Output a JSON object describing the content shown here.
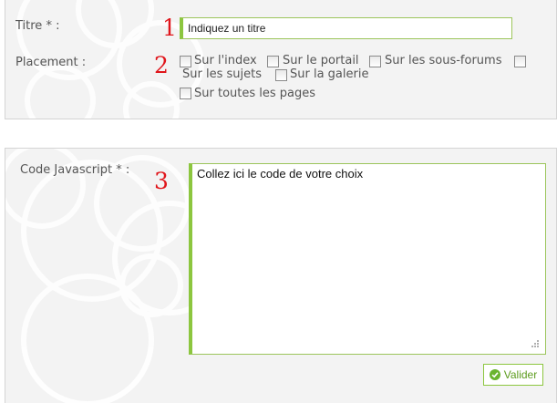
{
  "title_field": {
    "label": "Titre * :",
    "step": "1",
    "placeholder": "Indiquez un titre"
  },
  "placement_field": {
    "label": "Placement :",
    "step": "2",
    "options": [
      {
        "label": "Sur l'index",
        "checked": false
      },
      {
        "label": "Sur le portail",
        "checked": false
      },
      {
        "label": "Sur les sous-forums",
        "checked": false
      },
      {
        "label": "Sur les sujets",
        "checked": false
      },
      {
        "label": "Sur la galerie",
        "checked": false
      },
      {
        "label": "Sur toutes les pages",
        "checked": false
      }
    ]
  },
  "code_field": {
    "label": "Code Javascript * :",
    "step": "3",
    "placeholder": "Collez ici le code de votre choix"
  },
  "submit": {
    "label": "Valider",
    "icon": "check-circle-icon"
  },
  "colors": {
    "accent": "#8cc63f",
    "step_number": "#e0151b",
    "panel_bg": "#f3f3f3",
    "button_text": "#5d9c1e"
  }
}
